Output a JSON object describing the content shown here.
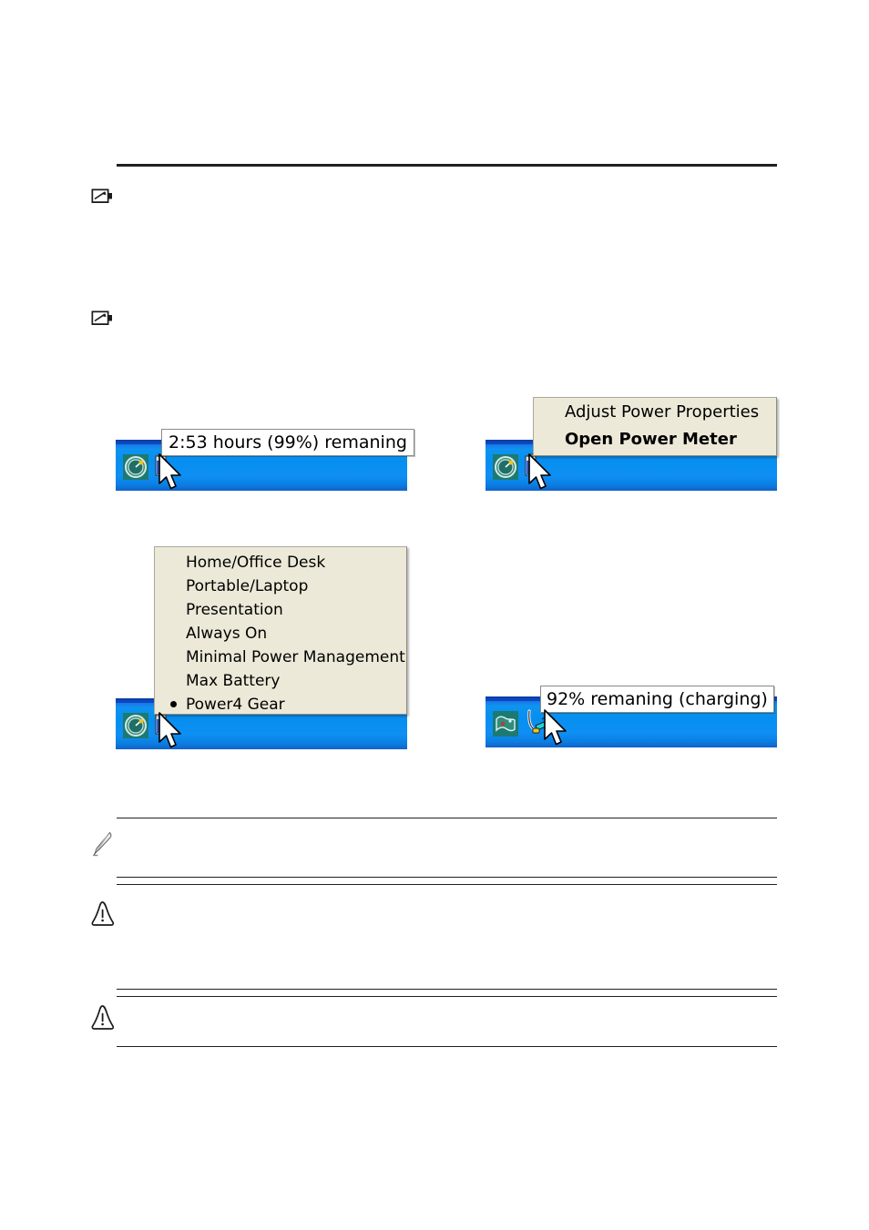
{
  "page": {
    "background": "#ffffff",
    "rule_color": "#231f20"
  },
  "callouts": [
    {
      "id": "important-top-1",
      "icon": "important-note-icon",
      "type": "important"
    },
    {
      "id": "important-top-2",
      "icon": "important-note-icon",
      "type": "important"
    },
    {
      "id": "note-bottom",
      "icon": "pencil-note-icon",
      "type": "note"
    },
    {
      "id": "warning-1",
      "icon": "warning-triangle-icon",
      "type": "warning"
    },
    {
      "id": "warning-2",
      "icon": "warning-triangle-icon",
      "type": "warning"
    }
  ],
  "figures": {
    "battery_tooltip": {
      "name": "battery-status-tooltip-figure",
      "tooltip_text": "2:53 hours (99%) remaning",
      "tray_icons": [
        {
          "name": "power-meter-gauge-icon",
          "label": "power meter"
        },
        {
          "name": "battery-tray-icon",
          "label": "battery"
        }
      ],
      "cursor": "arrow-cursor"
    },
    "power_menu": {
      "name": "battery-right-click-menu-figure",
      "items": [
        {
          "label": "Adjust Power Properties",
          "bold": false,
          "selected": false
        },
        {
          "label": "Open Power Meter",
          "bold": true,
          "selected": false
        }
      ],
      "tray_icons": [
        {
          "name": "power-meter-gauge-icon",
          "label": "power meter"
        },
        {
          "name": "battery-tray-icon",
          "label": "battery"
        }
      ],
      "cursor": "arrow-cursor"
    },
    "power_schemes": {
      "name": "power-schemes-menu-figure",
      "items": [
        {
          "label": "Home/Office Desk",
          "selected": false
        },
        {
          "label": "Portable/Laptop",
          "selected": false
        },
        {
          "label": "Presentation",
          "selected": false
        },
        {
          "label": "Always On",
          "selected": false
        },
        {
          "label": "Minimal Power Management",
          "selected": false
        },
        {
          "label": "Max Battery",
          "selected": false
        },
        {
          "label": "Power4 Gear",
          "selected": true
        }
      ],
      "tray_icons": [
        {
          "name": "power-meter-gauge-icon",
          "label": "power meter"
        },
        {
          "name": "battery-tray-icon",
          "label": "battery"
        }
      ],
      "cursor": "arrow-cursor"
    },
    "charging_tooltip": {
      "name": "charging-status-tooltip-figure",
      "tooltip_text": "92% remaning (charging)",
      "tray_icons": [
        {
          "name": "network-map-tray-icon",
          "label": "network"
        },
        {
          "name": "power-plug-charging-icon",
          "label": "charging plug"
        }
      ],
      "cursor": "arrow-cursor"
    }
  },
  "colors": {
    "taskbar_blue": "#0f8ff3",
    "taskbar_edge": "#0b3fa8",
    "menu_bg": "#ece9d8",
    "menu_border": "#aca899",
    "tooltip_bg": "#ffffff",
    "tray_icon_teal": "#1f7a6e"
  }
}
